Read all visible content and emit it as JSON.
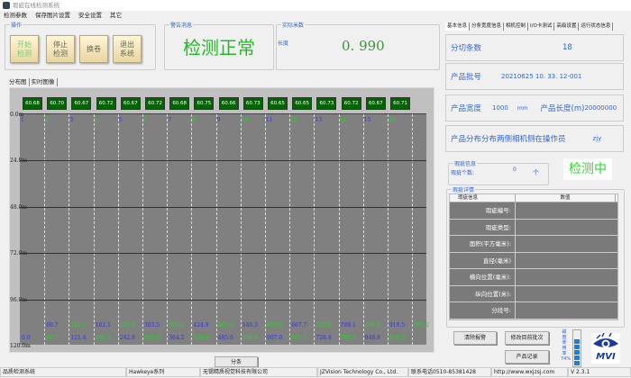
{
  "window": {
    "title": "瑕疵在线检测系统"
  },
  "menu": [
    "检测参数",
    "保存图片设置",
    "安全设置",
    "其它"
  ],
  "ops": {
    "title": "操作",
    "buttons": [
      "开始\n检测",
      "停止\n检测",
      "换卷",
      "退出\n系统"
    ]
  },
  "warning": {
    "title": "警告消息",
    "message": "检测正常",
    "color": "#22bb22"
  },
  "realtime": {
    "title": "实际米数",
    "label": "长度",
    "value": "0. 990"
  },
  "chart_tabs": [
    "分布图",
    "实时图像"
  ],
  "chart_data": {
    "type": "table",
    "lane_width_values": [
      "60.68",
      "60.70",
      "60.67",
      "60.72",
      "60.67",
      "60.72",
      "60.68",
      "60.75",
      "60.66",
      "60.73",
      "60.65",
      "60.65",
      "60.73",
      "60.72",
      "60.67",
      "60.71"
    ],
    "lane_numbers": [
      "1",
      "2",
      "3",
      "4",
      "5",
      "6",
      "7",
      "8",
      "9",
      "10",
      "11",
      "12",
      "13",
      "14",
      "15",
      "16"
    ],
    "y_ticks": [
      "0.0m",
      "24.0m",
      "48.0m",
      "72.0m",
      "96.0m",
      "120.0m"
    ],
    "ylim": [
      0,
      120
    ],
    "position_row1": [
      "",
      "60.7",
      "121.4",
      "182.1",
      "242.8",
      "303.5",
      "364.2",
      "424.9",
      "485.6",
      "546.3",
      "607.0",
      "667.7",
      "728.4",
      "789.1",
      "849.8",
      "910.5",
      "971.2"
    ],
    "position_row2": [
      "0.0",
      "60.7",
      "121.4",
      "182.1",
      "242.8",
      "303.5",
      "364.2",
      "424.9",
      "485.6",
      "546.3",
      "607.0",
      "667.7",
      "728.4",
      "789.1",
      "849.8",
      "910.5",
      ""
    ],
    "colors": {
      "odd": "#3333cc",
      "even": "#33cc33",
      "box": "#006400",
      "plot": "#808080"
    }
  },
  "split_button": "分条",
  "right_tabs": [
    "基本信息",
    "分条宽度信息",
    "相机控制",
    "I/O卡测试",
    "高级设置",
    "运行状态信息"
  ],
  "basic": {
    "split_label": "分切条数",
    "split_value": "18",
    "batch_label": "产品批号",
    "batch_value": "20210625  10. 33. 12-001",
    "width_label": "产品宽度",
    "width_value": "1000",
    "width_unit": "mm",
    "length_label": "产品长度(m)",
    "length_value": "20000000",
    "operator_label": "产品分布分布两侧相机侧在操作员",
    "operator_value": "zjy"
  },
  "defect_info": {
    "title": "瑕疵信息",
    "count_label": "瑕疵个数:",
    "count_value": "0",
    "count_unit": "个",
    "status": "检测中"
  },
  "defect_detail": {
    "title": "瑕疵详情",
    "headers": [
      "瑕疵信息",
      "数值"
    ],
    "rows": [
      "瑕疵编号:",
      "瑕疵类型:",
      "面积(平方毫米):",
      "直径(毫米)",
      "横向位置(毫米):",
      "纵向位置(米):",
      "分段号:"
    ]
  },
  "bottom_buttons": {
    "clear": "清除报警",
    "change_batch": "修改目前批次",
    "record": "产品记录"
  },
  "disk": {
    "label": "磁盘使用率",
    "percent": "74%",
    "level": 0.74
  },
  "brand": "MVI",
  "statusbar": [
    "品质检测系统",
    "Hawkeye系列",
    "无锡精质视觉科技有限公司",
    "JZVision Technology Co., Ltd.",
    "联系电话0510-85381428",
    "http://www.wxjzsj.com",
    "V 2.3.1"
  ]
}
